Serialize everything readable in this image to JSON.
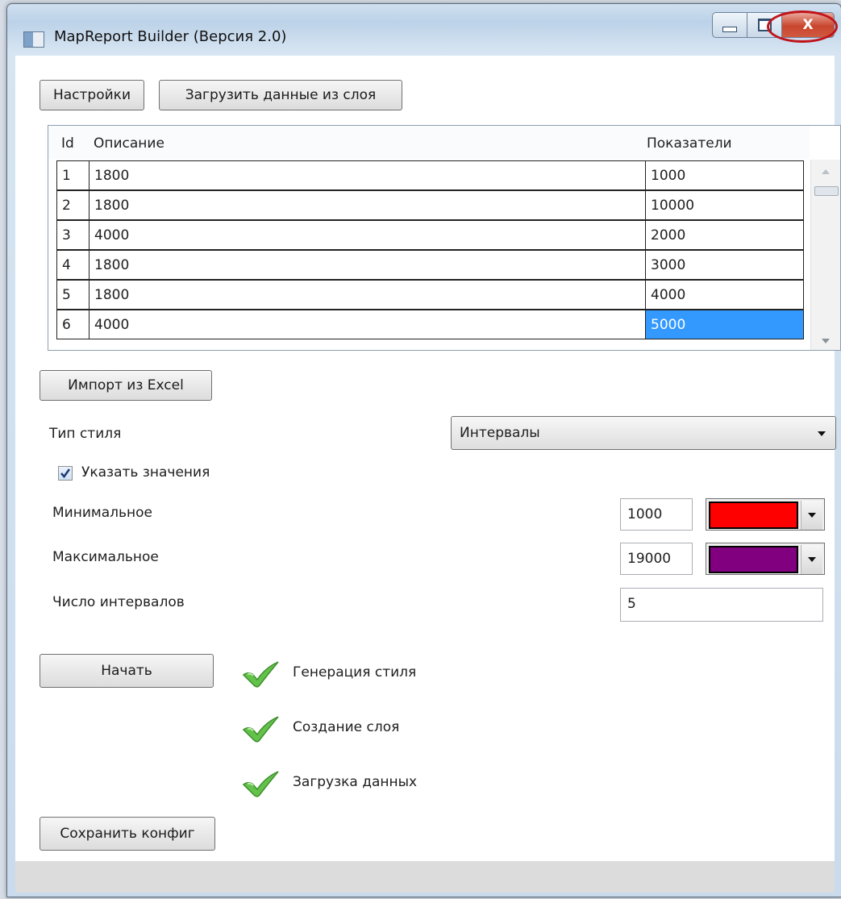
{
  "window": {
    "title": "MapReport Builder (Версия 2.0)",
    "close_glyph": "X"
  },
  "toolbar": {
    "settings_label": "Настройки",
    "load_label": "Загрузить данные из слоя"
  },
  "table": {
    "headers": {
      "id": "Id",
      "description": "Описание",
      "metrics": "Показатели"
    },
    "rows": [
      {
        "id": "1",
        "description": "1800",
        "metrics": "1000"
      },
      {
        "id": "2",
        "description": "1800",
        "metrics": "10000"
      },
      {
        "id": "3",
        "description": "4000",
        "metrics": "2000"
      },
      {
        "id": "4",
        "description": "1800",
        "metrics": "3000"
      },
      {
        "id": "5",
        "description": "1800",
        "metrics": "4000"
      },
      {
        "id": "6",
        "description": "4000",
        "metrics": "5000"
      }
    ],
    "selected_row": 6
  },
  "import": {
    "label": "Импорт из Excel"
  },
  "style": {
    "type_label": "Тип стиля",
    "type_value": "Интервалы",
    "specify_values_label": "Указать значения",
    "specify_values_checked": true,
    "min_label": "Минимальное",
    "min_value": "1000",
    "min_color": "#ff0000",
    "max_label": "Максимальное",
    "max_value": "19000",
    "max_color": "#800080",
    "intervals_label": "Число интервалов",
    "intervals_value": "5"
  },
  "actions": {
    "start_label": "Начать",
    "save_config_label": "Сохранить конфиг"
  },
  "progress": [
    {
      "icon": "check-icon",
      "label": "Генерация стиля"
    },
    {
      "icon": "check-icon",
      "label": "Создание слоя"
    },
    {
      "icon": "check-icon",
      "label": "Загрузка данных"
    }
  ]
}
